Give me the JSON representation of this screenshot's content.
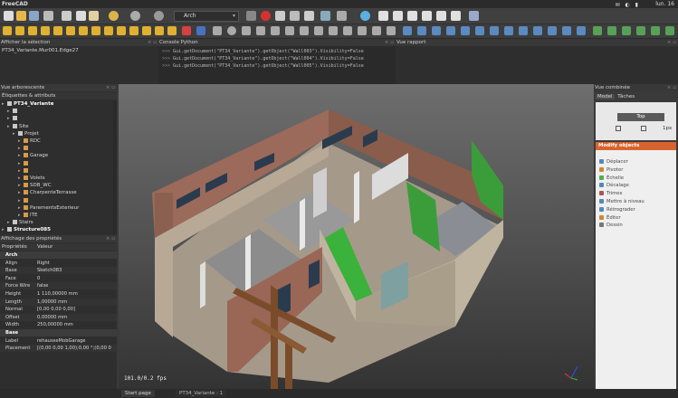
{
  "titlebar": {
    "title": "FreeCAD",
    "clock": "lun. 16",
    "sys_icons": "✉ ◐ ▮"
  },
  "toolbar": {
    "workbench": "Arch"
  },
  "selection_panel": {
    "title": "Afficher la sélection",
    "text": "PT34_Variante.Mur001.Edge27"
  },
  "python_panel": {
    "title": "Console Python",
    "lines": [
      {
        "prompt": ">>>",
        "text": "Gui.getDocument(\"PT34_Variante\").getObject(\"Wall003\").Visibility=False"
      },
      {
        "prompt": ">>>",
        "text": "Gui.getDocument(\"PT34_Variante\").getObject(\"Wall004\").Visibility=False"
      },
      {
        "prompt": ">>>",
        "text": "Gui.getDocument(\"PT34_Variante\").getObject(\"Wall005\").Visibility=False"
      }
    ]
  },
  "report_panel": {
    "title": "Vue rapport"
  },
  "tree_panel": {
    "title": "Vue arborescente",
    "tab": "Étiquettes & attributs",
    "items": [
      {
        "label": "PT34_Variante",
        "level": 0,
        "bold": true
      },
      {
        "label": "",
        "level": 1
      },
      {
        "label": "",
        "level": 1
      },
      {
        "label": "Site",
        "level": 1
      },
      {
        "label": "Projet",
        "level": 2
      },
      {
        "label": "RDC",
        "level": 3
      },
      {
        "label": "",
        "level": 3
      },
      {
        "label": "Garage",
        "level": 3
      },
      {
        "label": "",
        "level": 3
      },
      {
        "label": "",
        "level": 3
      },
      {
        "label": "Volets",
        "level": 3
      },
      {
        "label": "SDB_WC",
        "level": 3
      },
      {
        "label": "CharpenteTerrasse",
        "level": 3
      },
      {
        "label": "",
        "level": 3
      },
      {
        "label": "ParementsExterieur",
        "level": 3
      },
      {
        "label": "ITE",
        "level": 3
      },
      {
        "label": "Stairs",
        "level": 1
      },
      {
        "label": "Structure085",
        "level": 0,
        "bold": true
      }
    ]
  },
  "properties_panel": {
    "title": "Affichage des propriétés",
    "col_key": "Propriétés",
    "col_val": "Valeur",
    "rows": [
      {
        "k": "Arch",
        "v": "",
        "group": true
      },
      {
        "k": "Align",
        "v": "Right"
      },
      {
        "k": "Base",
        "v": "Sketch083"
      },
      {
        "k": "Face",
        "v": "0"
      },
      {
        "k": "Force Wire",
        "v": "false"
      },
      {
        "k": "Height",
        "v": "1 110,00000 mm"
      },
      {
        "k": "Length",
        "v": "1,00000 mm"
      },
      {
        "k": "Normal",
        "v": "[0,00 0,00 0,00]"
      },
      {
        "k": "Offset",
        "v": "0,00000 mm"
      },
      {
        "k": "Width",
        "v": "250,00000 mm"
      },
      {
        "k": "Base",
        "v": "",
        "group": true
      },
      {
        "k": "Label",
        "v": "rehausseMobGarage"
      },
      {
        "k": "Placement",
        "v": "[(0,00 0,00 1,00);0,00 °;(0,00 0"
      }
    ]
  },
  "viewport": {
    "fps": "101.0/0.2 fps"
  },
  "combo": {
    "title": "Vue combinée",
    "tabs": [
      "Model",
      "Tâches"
    ],
    "top_button": "Top",
    "unit": "1px",
    "modify_title": "Modify objects",
    "modify_items": [
      "Déplacer",
      "Pivoter",
      "Échelle",
      "Décalage",
      "Trimex",
      "Mettre à niveau",
      "Rétrograder",
      "Éditer",
      "Dessin"
    ]
  },
  "statusbar": {
    "tabs": [
      "Start page",
      "PT34_Variante : 1"
    ]
  },
  "colors": {
    "accent_orange": "#d8632e",
    "highlight_green": "#3a9d3a",
    "wall_brick": "#9c6a5a"
  }
}
